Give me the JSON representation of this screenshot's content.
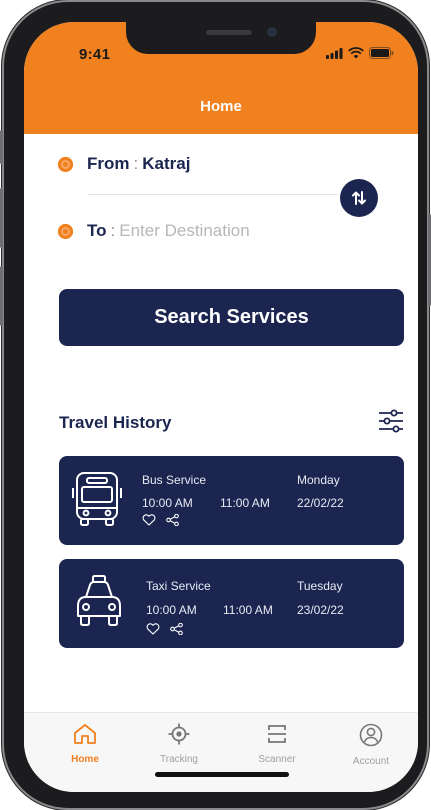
{
  "status": {
    "time": "9:41"
  },
  "header": {
    "title": "Home"
  },
  "route": {
    "from_label": "From",
    "from_value": "Katraj",
    "to_label": "To",
    "to_placeholder": "Enter Destination",
    "separator": ":"
  },
  "search": {
    "label": "Search Services"
  },
  "history": {
    "title": "Travel History",
    "cards": [
      {
        "service": "Bus Service",
        "day": "Monday",
        "depart": "10:00 AM",
        "arrive": "11:00 AM",
        "date": "22/02/22",
        "icon": "bus-icon"
      },
      {
        "service": "Taxi Service",
        "day": "Tuesday",
        "depart": "10:00 AM",
        "arrive": "11:00 AM",
        "date": "23/02/22",
        "icon": "taxi-icon"
      }
    ]
  },
  "nav": [
    {
      "label": "Home",
      "icon": "home-icon",
      "active": true
    },
    {
      "label": "Tracking",
      "icon": "tracking-icon",
      "active": false
    },
    {
      "label": "Scanner",
      "icon": "scanner-icon",
      "active": false
    },
    {
      "label": "Account",
      "icon": "account-icon",
      "active": false
    }
  ],
  "colors": {
    "accent": "#f1801f",
    "primary": "#1b2550"
  }
}
